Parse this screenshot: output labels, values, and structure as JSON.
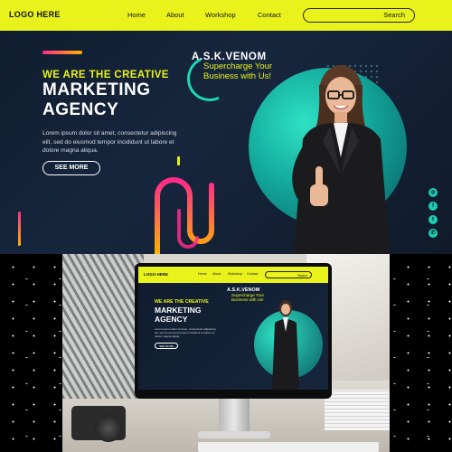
{
  "nav": {
    "logo": "LOGO HERE",
    "links": [
      "Home",
      "About",
      "Workshop",
      "Contact"
    ],
    "search_label": "Search"
  },
  "hero": {
    "tagline": "WE ARE THE CREATIVE",
    "headline_1": "MARKETING",
    "headline_2": "AGENCY",
    "body": "Lorem ipsum dolor sit amet, consectetur adipiscing elit, sed do eiusmod tempor incididunt ut labore et dolore magna aliqua.",
    "button": "SEE MORE",
    "brand_title": "A.S.K.VENOM",
    "brand_sub": "Supercharge Your Business with Us!"
  },
  "social": [
    "instagram-icon",
    "facebook-icon",
    "twitter-icon",
    "whatsapp-icon"
  ],
  "colors": {
    "accent_yellow": "#e9f21a",
    "teal": "#1ecdb0",
    "navy": "#0f1c2e",
    "pink": "#ff2a8a",
    "orange": "#ffb400"
  }
}
